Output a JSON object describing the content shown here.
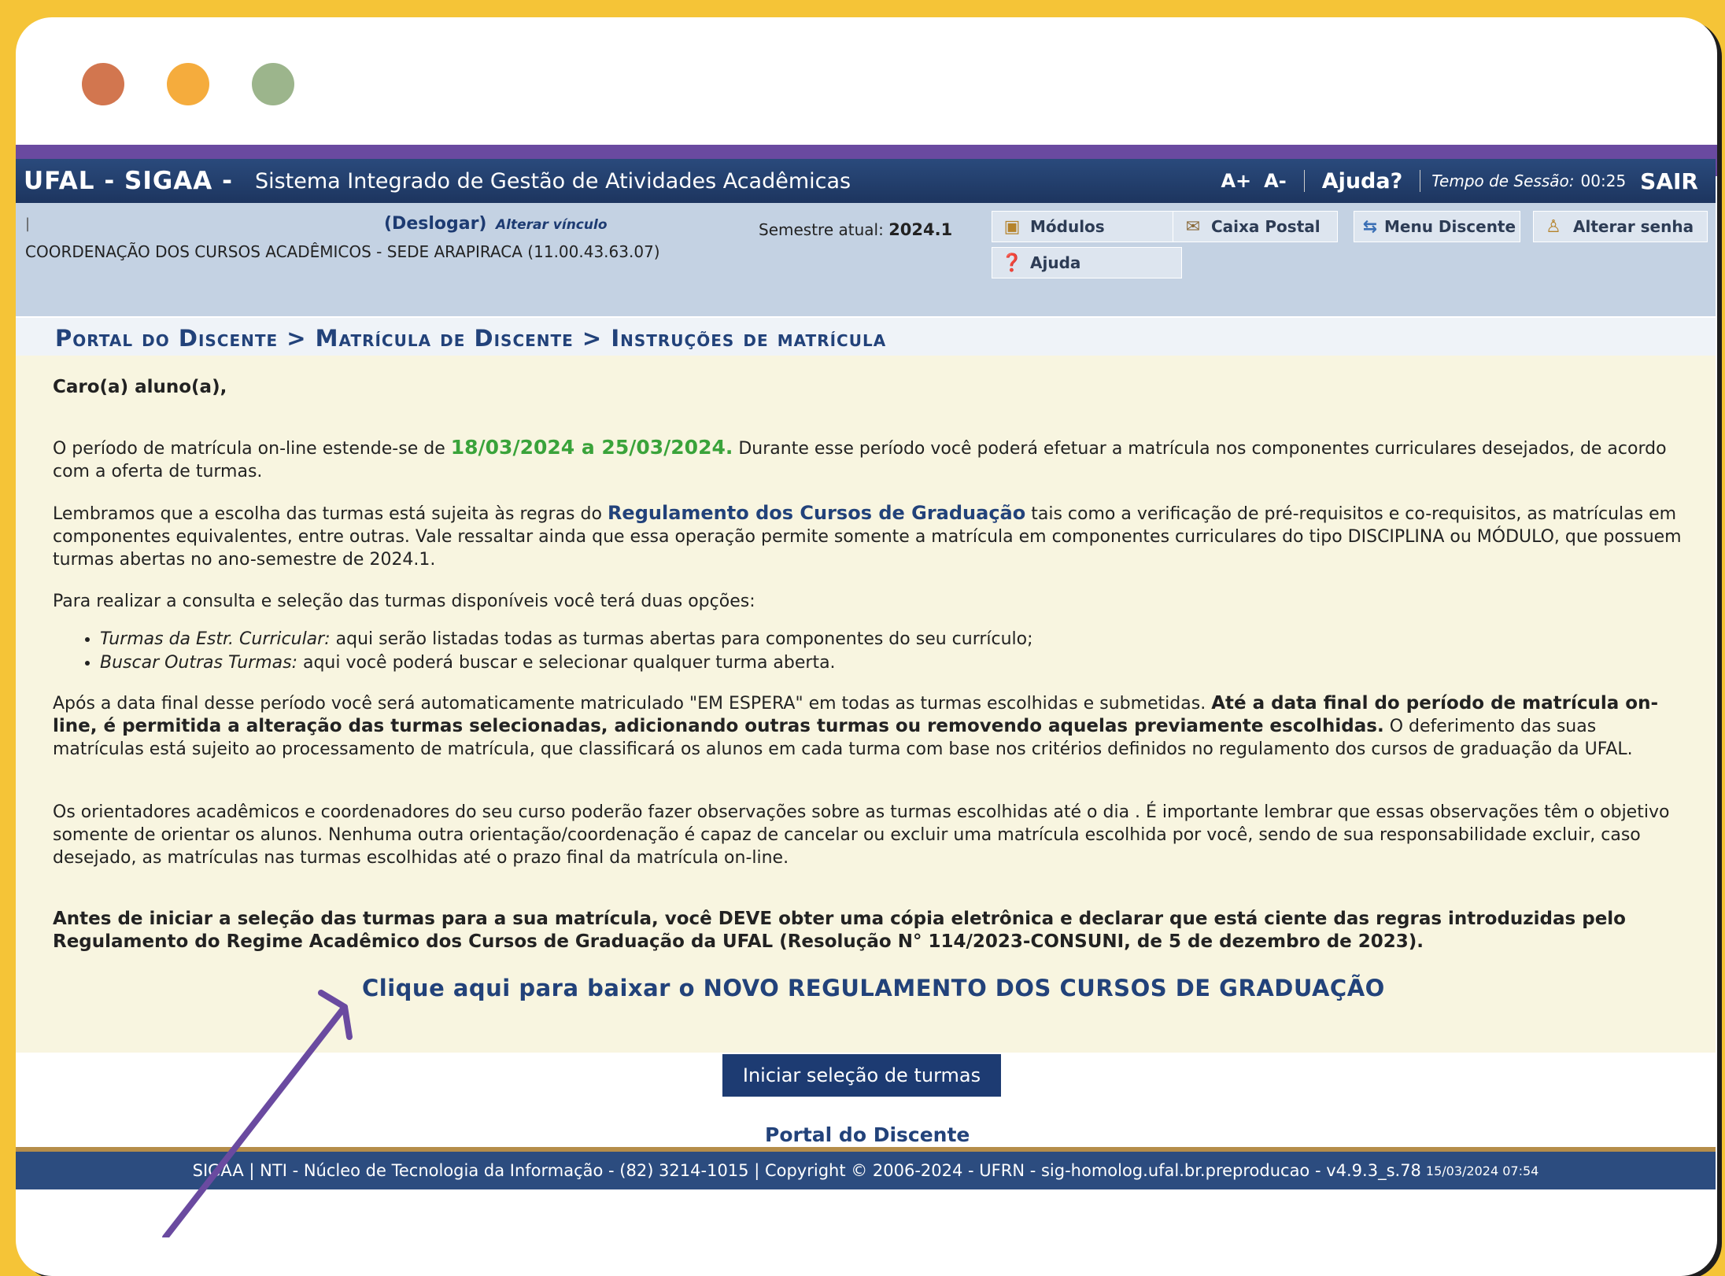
{
  "window_controls": {
    "close_color": "#d2764f",
    "minimize_color": "#f5ac3d",
    "maximize_color": "#9cb58c"
  },
  "header": {
    "brand": "UFAL - SIGAA -",
    "system_name": "Sistema Integrado de Gestão de Atividades Acadêmicas",
    "font_increase": "A+",
    "font_decrease": "A-",
    "help": "Ajuda?",
    "session_label": "Tempo de Sessão:",
    "session_time": "00:25",
    "logout": "SAIR"
  },
  "info": {
    "deslogar": "(Deslogar)",
    "alterar_vinculo": "Alterar vínculo",
    "coordination": "COORDENAÇÃO DOS CURSOS ACADÊMICOS - SEDE ARAPIRACA (11.00.43.63.07)",
    "semester_label": "Semestre atual:",
    "semester_value": "2024.1"
  },
  "menu": {
    "modulos": "Módulos",
    "caixa_postal": "Caixa Postal",
    "menu_discente": "Menu Discente",
    "alterar_senha": "Alterar senha",
    "ajuda": "Ajuda"
  },
  "breadcrumb": "Portal do Discente > Matrícula de Discente > Instruções de matrícula",
  "content": {
    "greeting": "Caro(a) aluno(a),",
    "p1_pre": "O período de matrícula on-line estende-se de ",
    "p1_dates": "18/03/2024 a 25/03/2024.",
    "p1_post": " Durante esse período você poderá efetuar a matrícula nos componentes curriculares desejados, de acordo com a oferta de turmas.",
    "p2_pre": "Lembramos que a escolha das turmas está sujeita às regras do ",
    "p2_link": "Regulamento dos Cursos de Graduação",
    "p2_post": " tais como a verificação de pré-requisitos e co-requisitos, as matrículas em componentes equivalentes, entre outras. Vale ressaltar ainda que essa operação permite somente a matrícula em componentes curriculares do tipo DISCIPLINA ou MÓDULO, que possuem turmas abertas no ano-semestre de 2024.1.",
    "p3": "Para realizar a consulta e seleção das turmas disponíveis você terá duas opções:",
    "opt1_label": "Turmas da Estr. Curricular:",
    "opt1_text": " aqui serão listadas todas as turmas abertas para componentes do seu currículo;",
    "opt2_label": "Buscar Outras Turmas:",
    "opt2_text": " aqui você poderá buscar e selecionar qualquer turma aberta.",
    "p4_pre": "Após a data final desse período você será automaticamente matriculado \"EM ESPERA\" em todas as turmas escolhidas e submetidas. ",
    "p4_bold": "Até a data final do período de matrícula on-line, é permitida a alteração das turmas selecionadas, adicionando outras turmas ou removendo aquelas previamente escolhidas.",
    "p4_post": " O deferimento das suas matrículas está sujeito ao processamento de matrícula, que classificará os alunos em cada turma com base nos critérios definidos no regulamento dos cursos de graduação da UFAL.",
    "p5": "Os orientadores acadêmicos e coordenadores do seu curso poderão fazer observações sobre as turmas escolhidas até o dia . É importante lembrar que essas observações têm o objetivo somente de orientar os alunos. Nenhuma outra orientação/coordenação é capaz de cancelar ou excluir uma matrícula escolhida por você, sendo de sua responsabilidade excluir, caso desejado, as matrículas nas turmas escolhidas até o prazo final da matrícula on-line.",
    "p6": "Antes de iniciar a seleção das turmas para a sua matrícula, você DEVE obter uma cópia eletrônica e declarar que está ciente das regras introduzidas pelo Regulamento do Regime Acadêmico dos Cursos de Graduação da UFAL (Resolução N° 114/2023-CONSUNI, de 5 de dezembro de 2023).",
    "download_link": "Clique aqui para baixar o NOVO REGULAMENTO DOS CURSOS DE GRADUAÇÃO"
  },
  "actions": {
    "start_button": "Iniciar seleção de turmas",
    "portal_link": "Portal do Discente"
  },
  "footer": {
    "text": "SIGAA | NTI - Núcleo de Tecnologia da Informação - (82) 3214-1015 | Copyright © 2006-2024 - UFRN - sig-homolog.ufal.br.preproducao - v4.9.3_s.78",
    "timestamp": "15/03/2024 07:54"
  },
  "annotation_color": "#6a4aa0"
}
